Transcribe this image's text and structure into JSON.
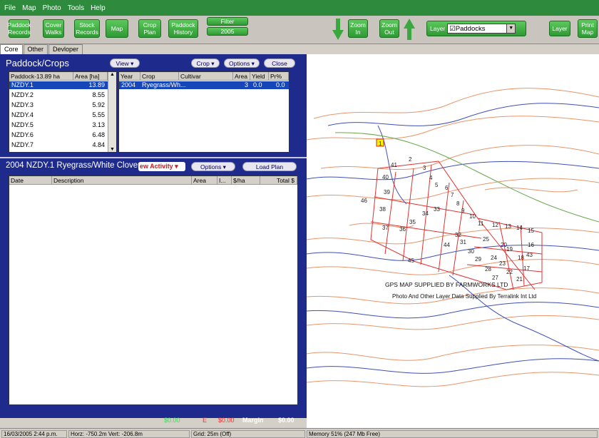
{
  "menu": [
    "File",
    "Map",
    "Photo",
    "Tools",
    "Help"
  ],
  "toolbar": {
    "paddock_records": "Paddock Records",
    "cover_walks": "Cover Walks",
    "stock_records": "Stock Records",
    "map": "Map",
    "crop_plan": "Crop Plan",
    "paddock_history": "Paddock History",
    "filter_label": "Filter",
    "filter_value": "2005",
    "zoom_in": "Zoom In",
    "zoom_out": "Zoom Out",
    "layer_label": "Layer",
    "layer_value": "☑Paddocks",
    "layer_button": "Layer",
    "print_map": "Print Map"
  },
  "tabs": [
    "Core",
    "Other",
    "Devloper"
  ],
  "paddock_panel": {
    "title": "Paddock/Crops",
    "view": "View ▾",
    "crop": "Crop ▾",
    "options": "Options ▾",
    "close": "Close",
    "list_headers": [
      "Paddock-13.89 ha",
      "Area [ha]"
    ],
    "paddocks": [
      {
        "name": "NZDY.1",
        "area": "13.89"
      },
      {
        "name": "NZDY.2",
        "area": "8.55"
      },
      {
        "name": "NZDY.3",
        "area": "5.92"
      },
      {
        "name": "NZDY.4",
        "area": "5.55"
      },
      {
        "name": "NZDY.5",
        "area": "3.13"
      },
      {
        "name": "NZDY.6",
        "area": "6.48"
      },
      {
        "name": "NZDY.7",
        "area": "4.84"
      }
    ],
    "crop_headers": [
      "Year",
      "Crop",
      "Cultivar",
      "Area",
      "Yield",
      "Pr%"
    ],
    "crops": [
      {
        "year": "2004",
        "crop": "Ryegrass/Wh...",
        "cultivar": "",
        "area": "3",
        "yield": "0.0",
        "pr": "0.0"
      }
    ]
  },
  "activity_panel": {
    "title": "2004 NZDY.1 Ryegrass/White Clover",
    "new_activity": "ew Activity ▾",
    "options": "Options ▾",
    "load_plan": "Load Plan",
    "headers": [
      "Date",
      "Description",
      "Area",
      "I...",
      "$/ha",
      "Total $"
    ],
    "footer": {
      "income": "$0.00",
      "expense_label": "E",
      "expense": "$0.00",
      "margin_label": "Margin",
      "margin": "$0.00"
    }
  },
  "map": {
    "credit1": "GPS MAP SUPPLIED BY FARMWORKS LTD",
    "credit2": "Photo And Other Layer Data Supplied By Terralink Int Ltd",
    "paddock_numbers": [
      "1",
      "2",
      "3",
      "4",
      "5",
      "6",
      "7",
      "8",
      "9",
      "10",
      "11",
      "12",
      "13",
      "14",
      "15",
      "16",
      "17",
      "18",
      "19",
      "20",
      "21",
      "22",
      "23",
      "24",
      "25",
      "27",
      "28",
      "29",
      "30",
      "31",
      "32",
      "33",
      "34",
      "35",
      "36",
      "37",
      "38",
      "39",
      "40",
      "41",
      "43",
      "44",
      "45",
      "46"
    ]
  },
  "status": {
    "date": "16/03/2005 2:44 p.m.",
    "coords": "Horz: -750.2m  Vert: -206.8m",
    "grid": "Grid: 25m (Off)",
    "memory": "Memory 51% (247 Mb Free)"
  },
  "colors": {
    "menubar": "#2e8b3e",
    "panel": "#1e2a8c",
    "green_button": "#3aa83e",
    "red_activity": "#d01818"
  }
}
